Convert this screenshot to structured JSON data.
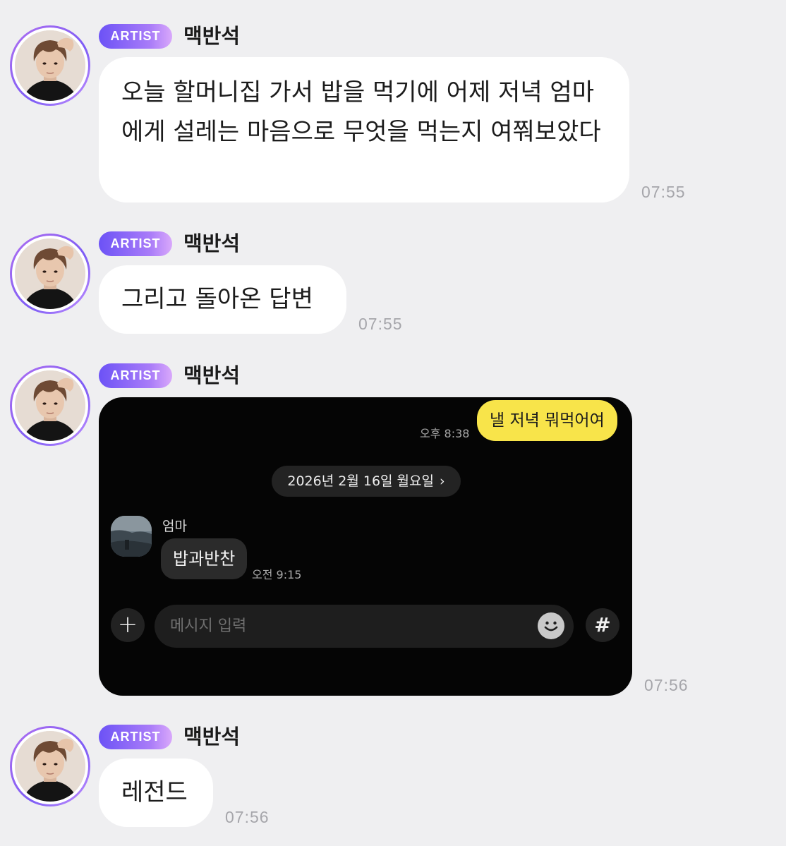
{
  "badge_label": "ARTIST",
  "sender_name": "맥반석",
  "messages": [
    {
      "text": "오늘 할머니집 가서 밥을 먹기에 어제 저녁 엄마에게 설레는 마음으로 무엇을 먹는지 여쭤보았다",
      "time": "07:55"
    },
    {
      "text": "그리고 돌아온 답변",
      "time": "07:55"
    },
    {
      "time": "07:56"
    },
    {
      "text": "레전드",
      "time": "07:56"
    }
  ],
  "embedded_chat": {
    "sent_message": {
      "text": "낼 저녁 뭐먹어여",
      "time": "오후 8:38"
    },
    "date_divider": {
      "text": "2026년 2월 16일 월요일",
      "chevron": "›"
    },
    "received_message": {
      "sender": "엄마",
      "text": "밥과반찬",
      "time": "오전 9:15"
    },
    "composer": {
      "plus_icon": "+",
      "placeholder": "메시지 입력",
      "emoji_icon": "smiley-icon",
      "hash_icon": "#"
    }
  }
}
